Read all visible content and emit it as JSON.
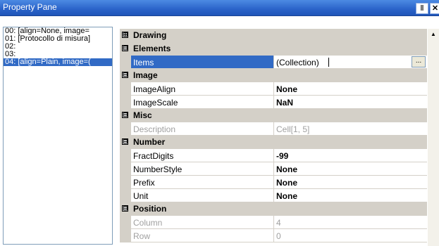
{
  "window": {
    "title": "Property Pane",
    "pin_glyph": "Ⅱ",
    "close_glyph": "✕"
  },
  "list": {
    "items": [
      {
        "text": "00: [align=None, image=",
        "selected": false
      },
      {
        "text": "01: [Protocollo di misura]",
        "selected": false
      },
      {
        "text": "02:",
        "selected": false
      },
      {
        "text": "03:",
        "selected": false
      },
      {
        "text": "04: [align=Plain, image=(",
        "selected": true
      }
    ]
  },
  "grid": {
    "categories": [
      {
        "label": "Drawing",
        "expander": "⊞",
        "props": []
      },
      {
        "label": "Elements",
        "expander": "⊟",
        "props": [
          {
            "name": "Items",
            "value": "(Collection)",
            "bold": false,
            "disabled": false,
            "selected": true,
            "button": "..."
          }
        ]
      },
      {
        "label": "Image",
        "expander": "⊟",
        "props": [
          {
            "name": "ImageAlign",
            "value": "None",
            "bold": true,
            "disabled": false
          },
          {
            "name": "ImageScale",
            "value": "NaN",
            "bold": true,
            "disabled": false
          }
        ]
      },
      {
        "label": "Misc",
        "expander": "⊟",
        "props": [
          {
            "name": "Description",
            "value": "Cell[1, 5]",
            "bold": false,
            "disabled": true
          }
        ]
      },
      {
        "label": "Number",
        "expander": "⊟",
        "props": [
          {
            "name": "FractDigits",
            "value": "-99",
            "bold": true,
            "disabled": false
          },
          {
            "name": "NumberStyle",
            "value": "None",
            "bold": true,
            "disabled": false
          },
          {
            "name": "Prefix",
            "value": "None",
            "bold": true,
            "disabled": false
          },
          {
            "name": "Unit",
            "value": "None",
            "bold": true,
            "disabled": false
          }
        ]
      },
      {
        "label": "Position",
        "expander": "⊟",
        "props": [
          {
            "name": "Column",
            "value": "4",
            "bold": false,
            "disabled": true
          },
          {
            "name": "Row",
            "value": "0",
            "bold": false,
            "disabled": true
          }
        ]
      }
    ]
  },
  "scrollbar": {
    "up_glyph": "▲"
  },
  "colors": {
    "titlebar": "#2a63c9",
    "selection": "#316ac5",
    "category_bg": "#d4d0c8",
    "disabled_text": "#a0a0a0"
  }
}
